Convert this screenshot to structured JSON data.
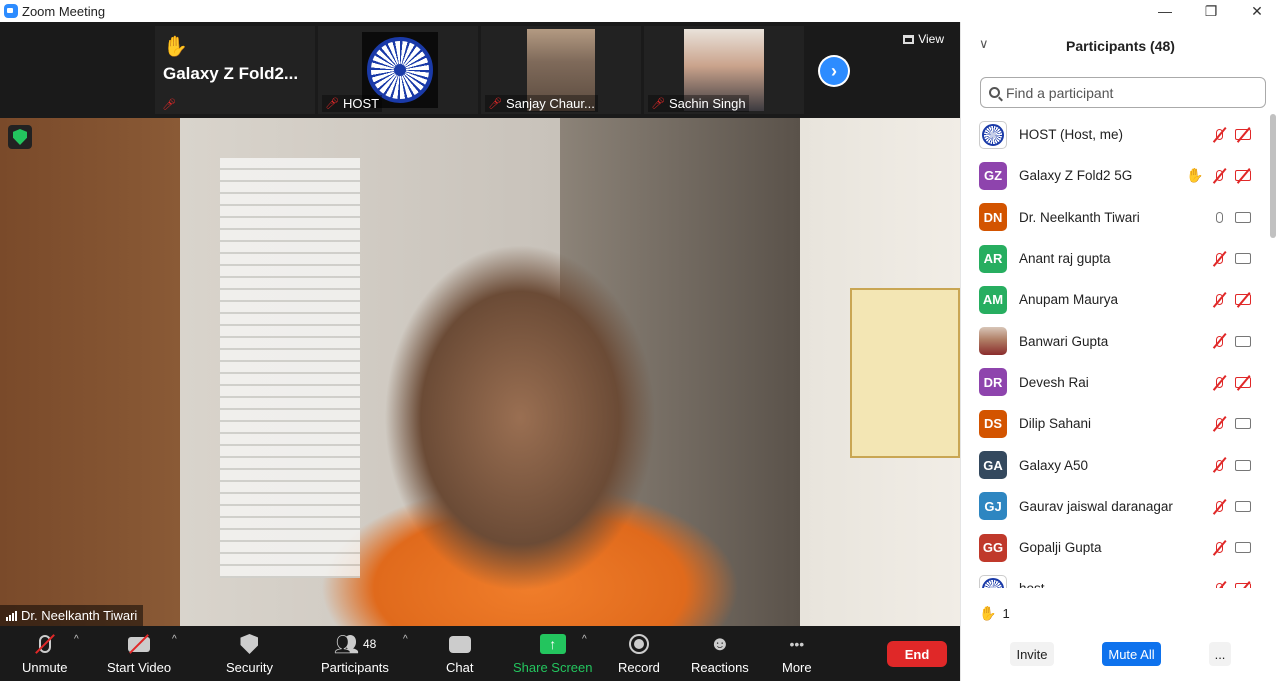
{
  "window": {
    "title": "Zoom Meeting",
    "minimize_icon": "—",
    "restore_icon": "❐",
    "close_icon": "✕"
  },
  "thumbnails": [
    {
      "name": "Galaxy Z Fold2...",
      "hand": "✋",
      "muted": true
    },
    {
      "name": "HOST",
      "muted": true
    },
    {
      "name": "Sanjay Chaur...",
      "muted": true
    },
    {
      "name": "Sachin Singh",
      "muted": true
    }
  ],
  "view_label": "View",
  "next_icon": "›",
  "active_speaker": "Dr. Neelkanth Tiwari",
  "toolbar": {
    "unmute": "Unmute",
    "start_video": "Start Video",
    "security": "Security",
    "participants": "Participants",
    "participant_count": "48",
    "chat": "Chat",
    "share_screen": "Share Screen",
    "share_icon": "↑",
    "record": "Record",
    "reactions": "Reactions",
    "reactions_icon": "☻",
    "more": "More",
    "more_icon": "•••",
    "end": "End",
    "caret": "^"
  },
  "panel": {
    "title": "Participants (48)",
    "collapse_icon": "∨",
    "search_placeholder": "Find a participant",
    "raised_hand_icon": "✋",
    "raised_count": "1",
    "invite": "Invite",
    "mute_all": "Mute All",
    "more": "..."
  },
  "participants": [
    {
      "name": "HOST (Host, me)",
      "initials": "",
      "color": "",
      "avatar": "chakra",
      "hand": false,
      "mic": "muted",
      "cam": "off"
    },
    {
      "name": "Galaxy Z Fold2 5G",
      "initials": "GZ",
      "color": "#8e44ad",
      "avatar": "",
      "hand": true,
      "mic": "muted",
      "cam": "off"
    },
    {
      "name": "Dr. Neelkanth Tiwari",
      "initials": "DN",
      "color": "#d35400",
      "avatar": "",
      "hand": false,
      "mic": "on",
      "cam": "on"
    },
    {
      "name": "Anant raj gupta",
      "initials": "AR",
      "color": "#27ae60",
      "avatar": "",
      "hand": false,
      "mic": "muted",
      "cam": "on"
    },
    {
      "name": "Anupam Maurya",
      "initials": "AM",
      "color": "#27ae60",
      "avatar": "",
      "hand": false,
      "mic": "muted",
      "cam": "off"
    },
    {
      "name": "Banwari Gupta",
      "initials": "",
      "color": "",
      "avatar": "photo",
      "hand": false,
      "mic": "muted",
      "cam": "on"
    },
    {
      "name": "Devesh Rai",
      "initials": "DR",
      "color": "#8e44ad",
      "avatar": "",
      "hand": false,
      "mic": "muted",
      "cam": "off"
    },
    {
      "name": "Dilip Sahani",
      "initials": "DS",
      "color": "#d35400",
      "avatar": "",
      "hand": false,
      "mic": "muted",
      "cam": "on"
    },
    {
      "name": "Galaxy A50",
      "initials": "GA",
      "color": "#34495e",
      "avatar": "",
      "hand": false,
      "mic": "muted",
      "cam": "on"
    },
    {
      "name": "Gaurav jaiswal daranagar",
      "initials": "GJ",
      "color": "#2e86c1",
      "avatar": "",
      "hand": false,
      "mic": "muted",
      "cam": "on"
    },
    {
      "name": "Gopalji Gupta",
      "initials": "GG",
      "color": "#c0392b",
      "avatar": "",
      "hand": false,
      "mic": "muted",
      "cam": "on"
    },
    {
      "name": "host",
      "initials": "",
      "color": "",
      "avatar": "chakra",
      "hand": false,
      "mic": "muted",
      "cam": "off"
    }
  ]
}
